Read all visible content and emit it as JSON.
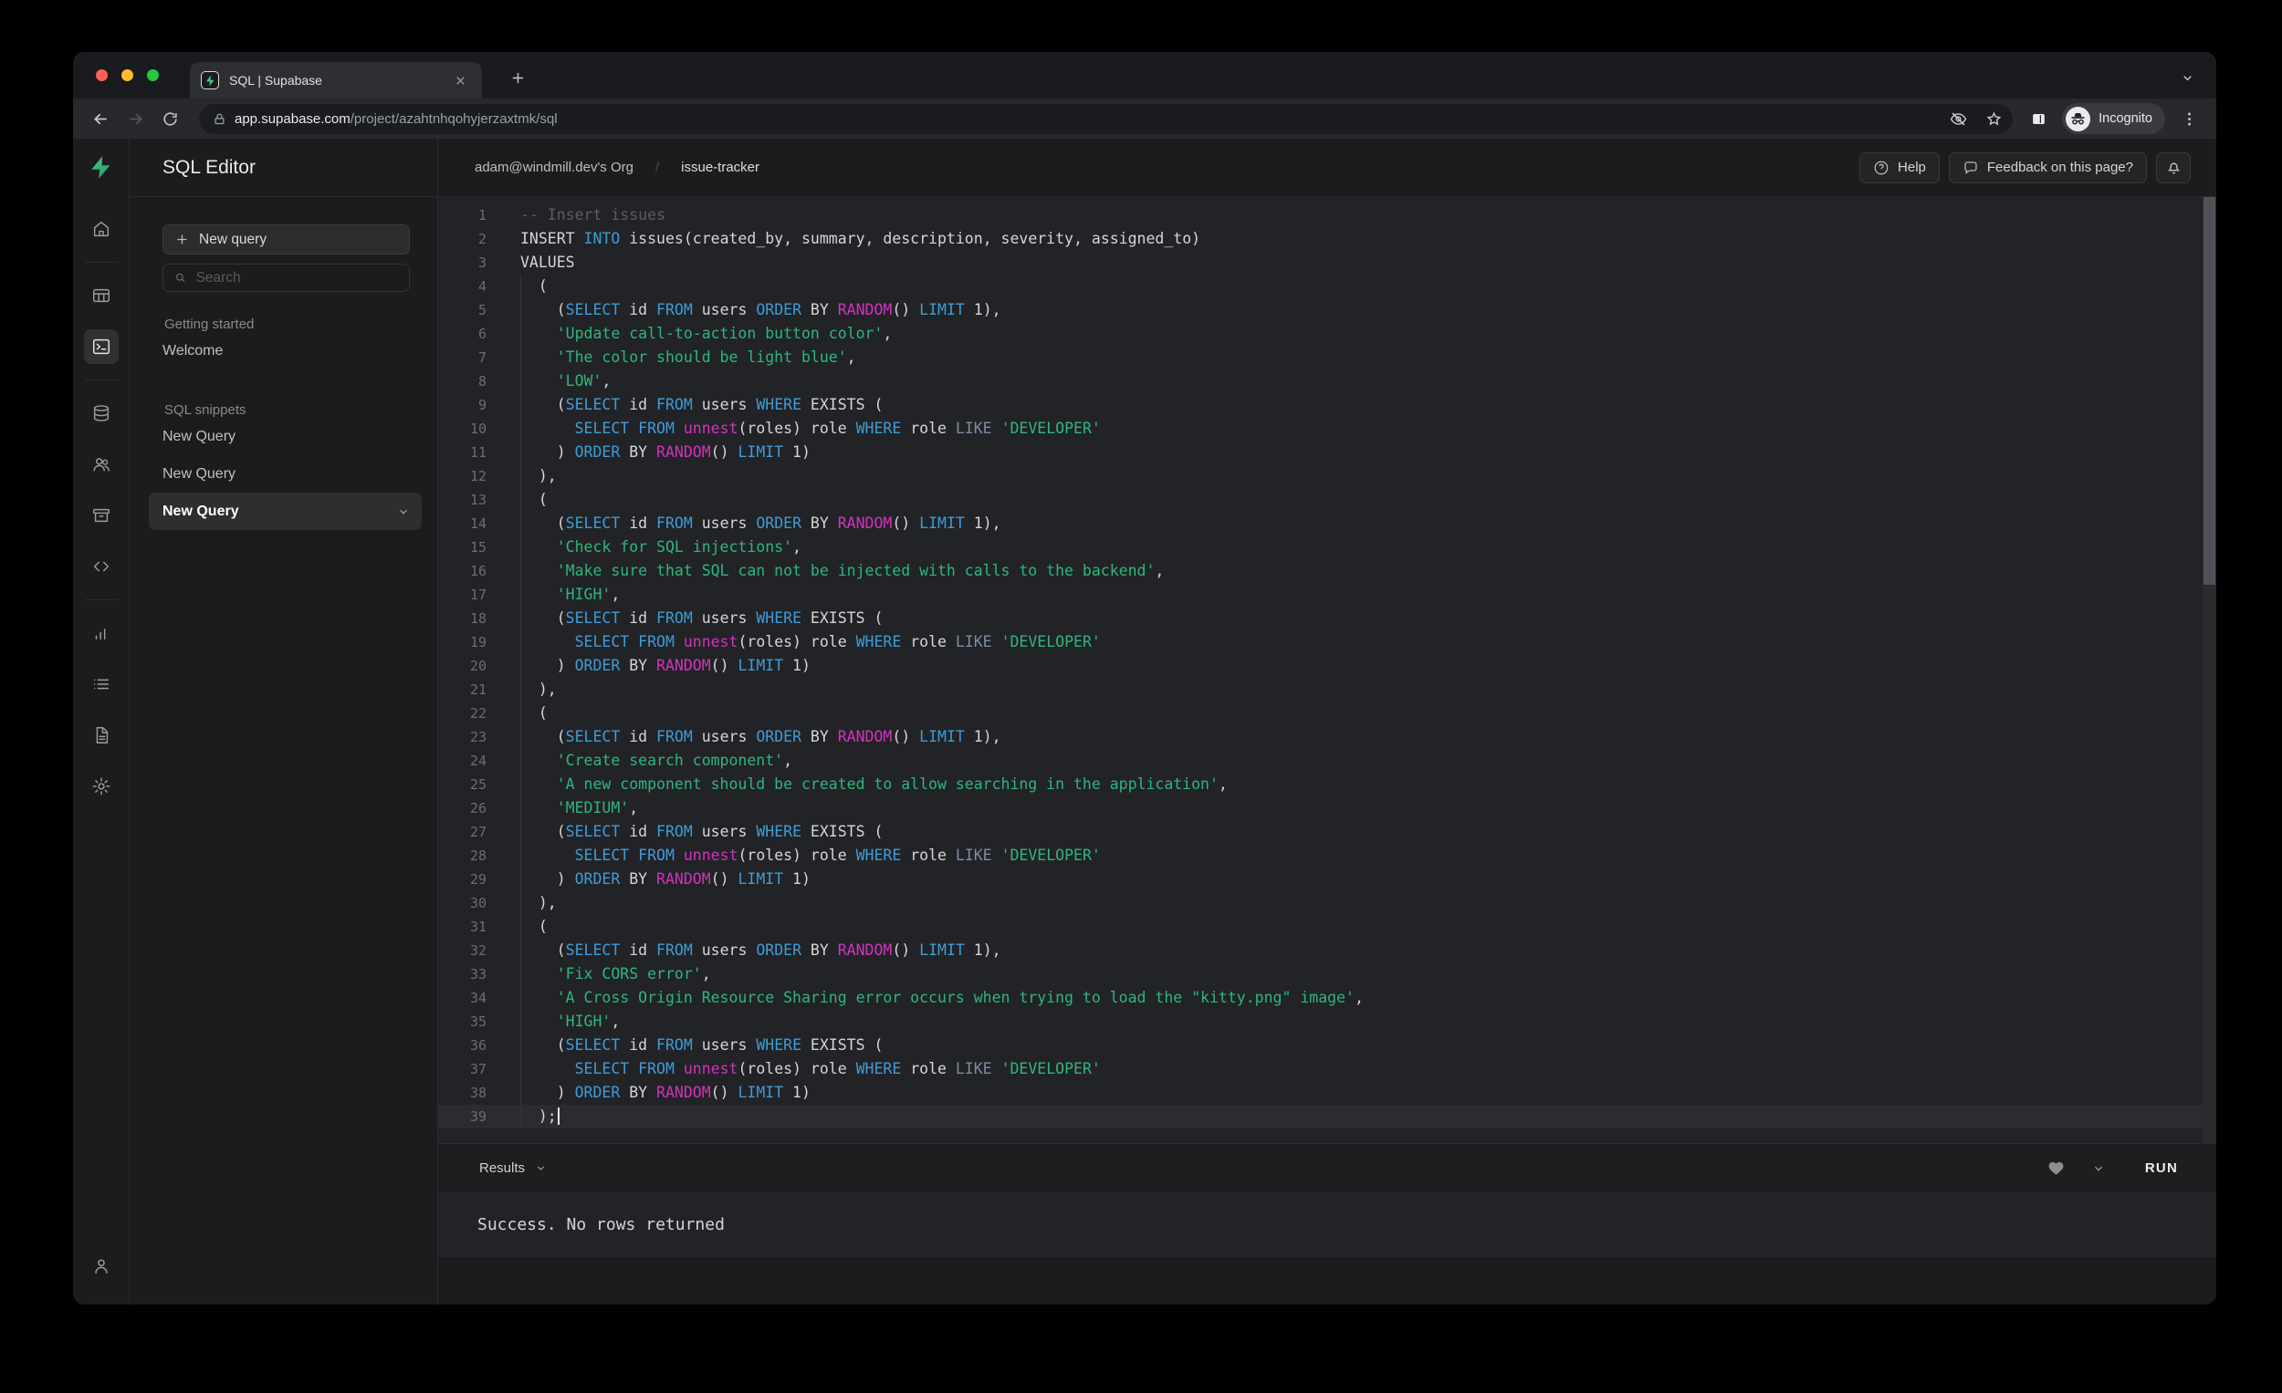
{
  "colors": {
    "brand_green": "#3ECF8E",
    "syntax_keyword": "#3f9cd7",
    "syntax_function": "#d233bd",
    "syntax_string": "#2eb67d",
    "syntax_comment": "#5d5d5d",
    "syntax_like": "#7d8ca6",
    "traffic_red": "#ff5f57",
    "traffic_yellow": "#febc2e",
    "traffic_green": "#28c840"
  },
  "browser": {
    "tab_title": "SQL | Supabase",
    "url_domain": "app.supabase.com",
    "url_path": "/project/azahtnhqohyjerzaxtmk/sql",
    "incognito_label": "Incognito"
  },
  "rail": {
    "groups": [
      [
        "home"
      ],
      [
        "table-editor",
        "sql-editor"
      ],
      [
        "database",
        "authentication",
        "storage",
        "api"
      ],
      [
        "reports",
        "logs",
        "docs",
        "settings"
      ]
    ],
    "active": "sql-editor",
    "bottom": "account"
  },
  "nav": {
    "title": "SQL Editor",
    "new_query_button": "New query",
    "search_placeholder": "Search",
    "sections": [
      {
        "label": "Getting started",
        "items": [
          {
            "label": "Welcome"
          }
        ]
      },
      {
        "label": "SQL snippets",
        "items": [
          {
            "label": "New Query"
          },
          {
            "label": "New Query"
          },
          {
            "label": "New Query",
            "active": true
          }
        ]
      }
    ]
  },
  "header": {
    "org": "adam@windmill.dev's Org",
    "project": "issue-tracker",
    "help_button": "Help",
    "feedback_button": "Feedback on this page?"
  },
  "editor": {
    "cursor_line": 39,
    "lines": [
      "-- Insert issues",
      "INSERT INTO issues(created_by, summary, description, severity, assigned_to)",
      "VALUES",
      "  (",
      "    (SELECT id FROM users ORDER BY RANDOM() LIMIT 1),",
      "    'Update call-to-action button color',",
      "    'The color should be light blue',",
      "    'LOW',",
      "    (SELECT id FROM users WHERE EXISTS (",
      "      SELECT FROM unnest(roles) role WHERE role LIKE 'DEVELOPER'",
      "    ) ORDER BY RANDOM() LIMIT 1)",
      "  ),",
      "  (",
      "    (SELECT id FROM users ORDER BY RANDOM() LIMIT 1),",
      "    'Check for SQL injections',",
      "    'Make sure that SQL can not be injected with calls to the backend',",
      "    'HIGH',",
      "    (SELECT id FROM users WHERE EXISTS (",
      "      SELECT FROM unnest(roles) role WHERE role LIKE 'DEVELOPER'",
      "    ) ORDER BY RANDOM() LIMIT 1)",
      "  ),",
      "  (",
      "    (SELECT id FROM users ORDER BY RANDOM() LIMIT 1),",
      "    'Create search component',",
      "    'A new component should be created to allow searching in the application',",
      "    'MEDIUM',",
      "    (SELECT id FROM users WHERE EXISTS (",
      "      SELECT FROM unnest(roles) role WHERE role LIKE 'DEVELOPER'",
      "    ) ORDER BY RANDOM() LIMIT 1)",
      "  ),",
      "  (",
      "    (SELECT id FROM users ORDER BY RANDOM() LIMIT 1),",
      "    'Fix CORS error',",
      "    'A Cross Origin Resource Sharing error occurs when trying to load the \"kitty.png\" image',",
      "    'HIGH',",
      "    (SELECT id FROM users WHERE EXISTS (",
      "      SELECT FROM unnest(roles) role WHERE role LIKE 'DEVELOPER'",
      "    ) ORDER BY RANDOM() LIMIT 1)",
      "  );"
    ]
  },
  "results": {
    "label": "Results",
    "run_button": "RUN",
    "message": "Success. No rows returned"
  }
}
